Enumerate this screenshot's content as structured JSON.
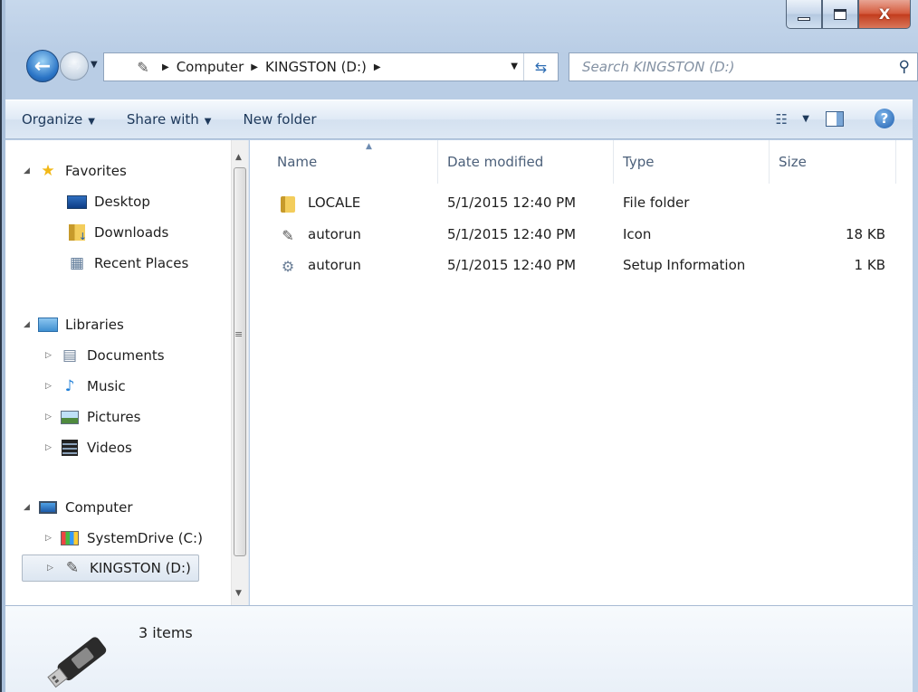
{
  "window": {
    "caption": {
      "minimize": "—",
      "maximize": "□",
      "close": "X"
    }
  },
  "address": {
    "crumbs": [
      "Computer",
      "KINGSTON (D:)"
    ],
    "search_placeholder": "Search KINGSTON (D:)"
  },
  "toolbar": {
    "organize": "Organize",
    "share_with": "Share with",
    "new_folder": "New folder",
    "help": "?"
  },
  "nav": {
    "favorites": "Favorites",
    "desktop": "Desktop",
    "downloads": "Downloads",
    "recent_places": "Recent Places",
    "libraries": "Libraries",
    "documents": "Documents",
    "music": "Music",
    "pictures": "Pictures",
    "videos": "Videos",
    "computer": "Computer",
    "system_drive": "SystemDrive (C:)",
    "kingston": "KINGSTON (D:)"
  },
  "columns": {
    "name": "Name",
    "date": "Date modified",
    "type": "Type",
    "size": "Size"
  },
  "files": [
    {
      "name": "LOCALE",
      "date": "5/1/2015 12:40 PM",
      "type": "File folder",
      "size": "",
      "icon": "folder-icon"
    },
    {
      "name": "autorun",
      "date": "5/1/2015 12:40 PM",
      "type": "Icon",
      "size": "18 KB",
      "icon": "usb-drive-icon"
    },
    {
      "name": "autorun",
      "date": "5/1/2015 12:40 PM",
      "type": "Setup Information",
      "size": "1 KB",
      "icon": "setup-file-icon"
    }
  ],
  "details": {
    "items": "3 items"
  }
}
